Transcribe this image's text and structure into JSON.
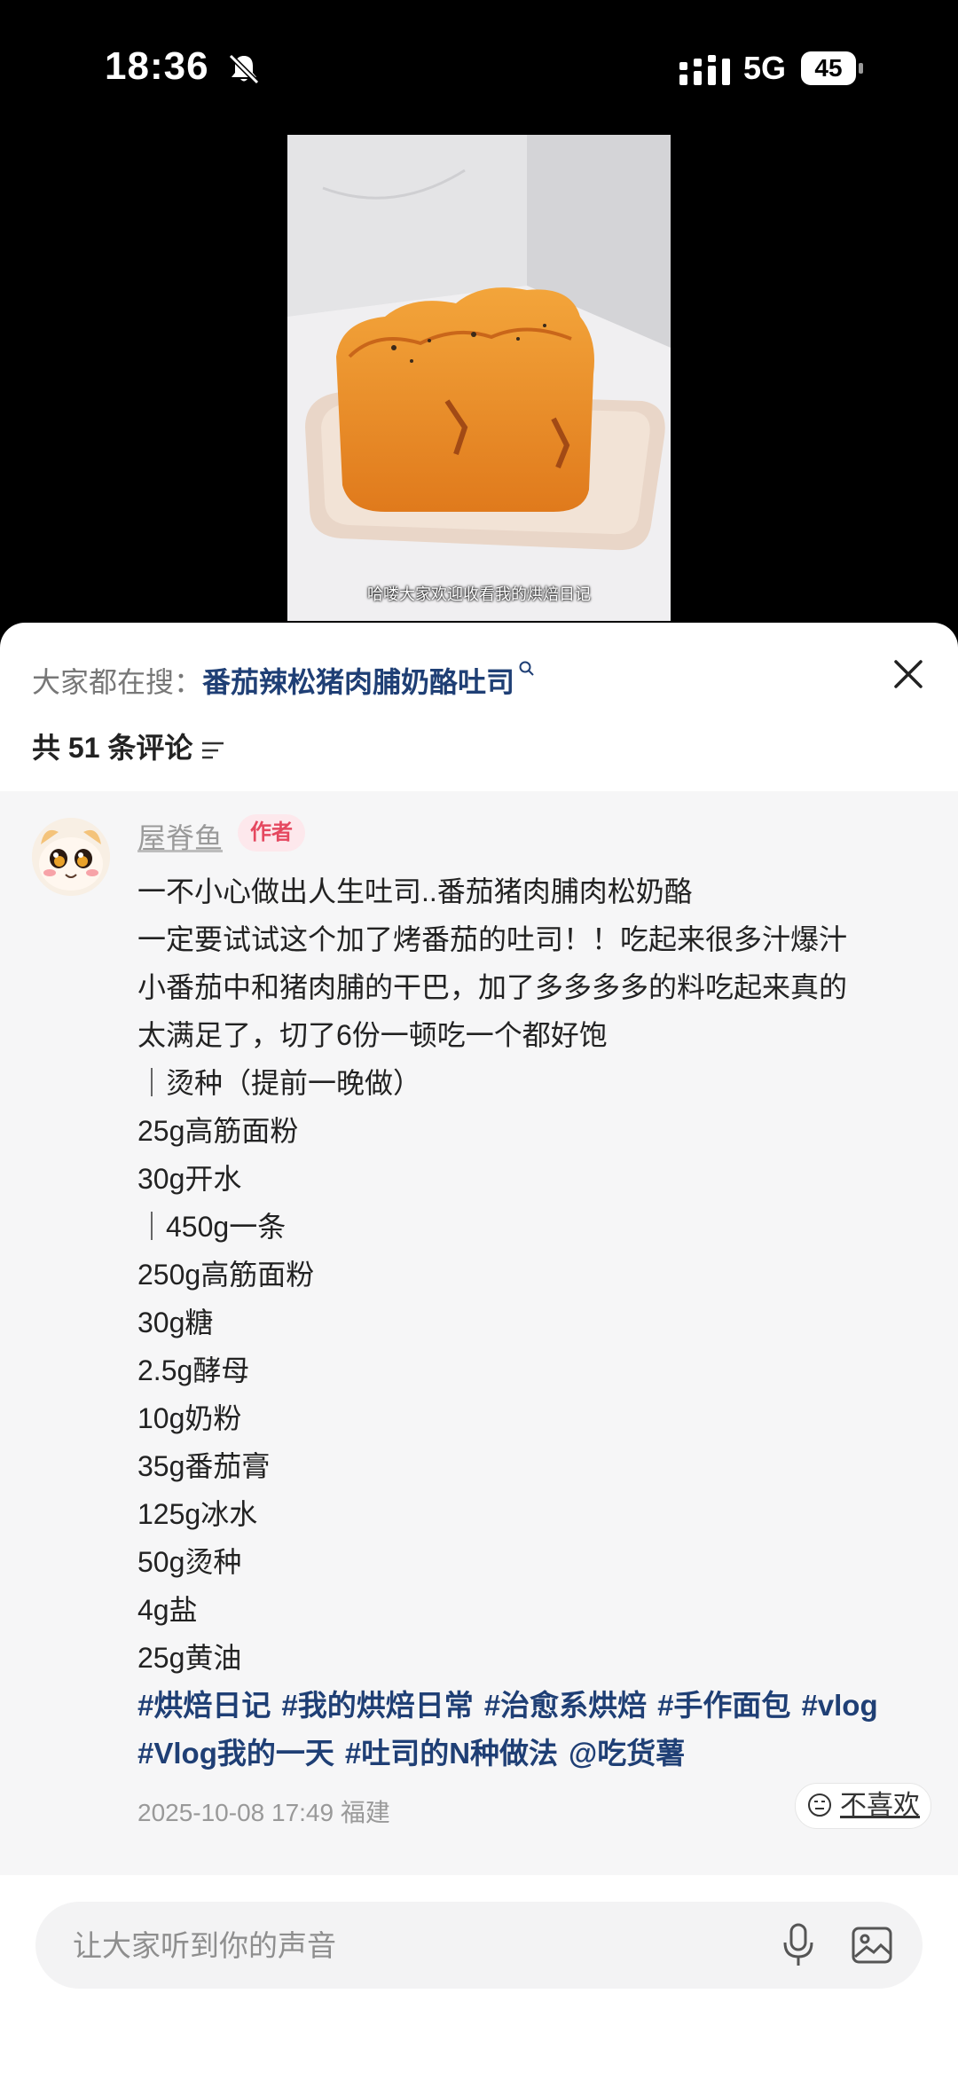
{
  "status_bar": {
    "time": "18:36",
    "network": "5G",
    "battery": "45"
  },
  "video": {
    "subtitle": "哈喽大家欢迎收看我的烘焙日记"
  },
  "search_bar": {
    "prefix": "大家都在搜：",
    "term": "番茄辣松猪肉脯奶酪吐司"
  },
  "comments_header": {
    "count_label": "共 51 条评论"
  },
  "comment": {
    "author": "屋脊鱼",
    "badge": "作者",
    "lines": [
      "一不小心做出人生吐司..番茄猪肉脯肉松奶酪",
      "一定要试试这个加了烤番茄的吐司！！吃起来很多汁爆汁",
      "小番茄中和猪肉脯的干巴，加了多多多多的料吃起来真的",
      "太满足了，切了6份一顿吃一个都好饱",
      "｜烫种（提前一晚做）",
      "25g高筋面粉",
      "30g开水",
      "｜450g一条",
      "250g高筋面粉",
      "30g糖",
      "2.5g酵母",
      "10g奶粉",
      "35g番茄膏",
      "125g冰水",
      "50g烫种",
      "4g盐",
      "25g黄油"
    ],
    "tags_line1": [
      "#烘焙日记",
      "#我的烘焙日常",
      "#治愈系烘焙",
      "#手作面包",
      "#vlog"
    ],
    "tags_line2": [
      "#Vlog我的一天",
      "#吐司的N种做法",
      "@吃货薯"
    ],
    "timestamp": "2025-10-08 17:49",
    "location": "福建",
    "dislike_label": "不喜欢"
  },
  "input_bar": {
    "placeholder": "让大家听到你的声音"
  },
  "icons": [
    "bell-muted-icon",
    "signal-icon",
    "battery-icon",
    "search-icon",
    "close-icon",
    "sort-icon",
    "dislike-face-icon",
    "microphone-icon",
    "image-icon"
  ]
}
